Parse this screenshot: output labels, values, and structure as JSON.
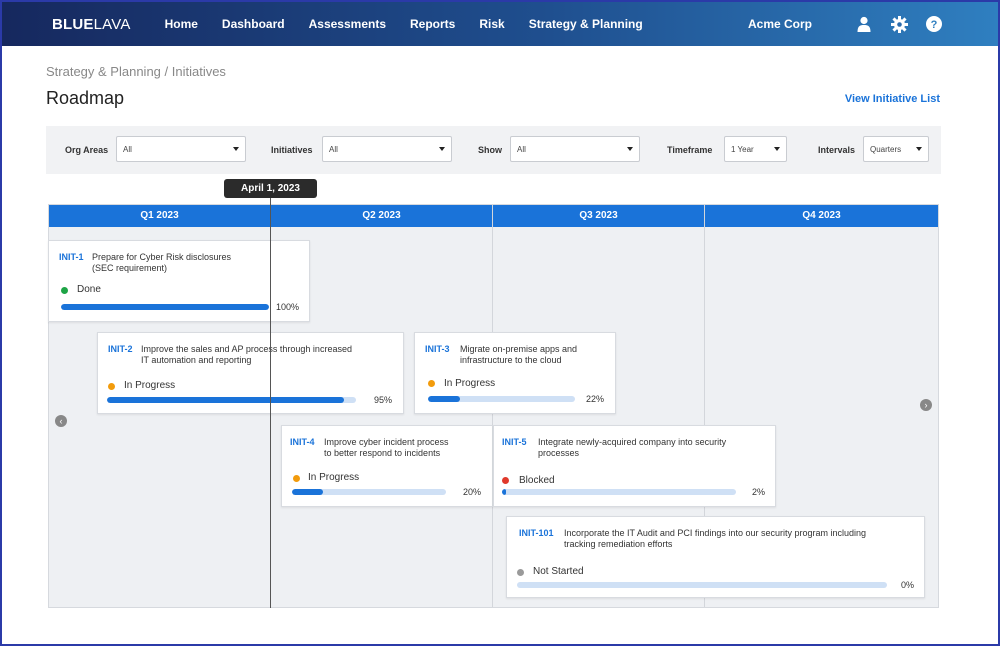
{
  "app": {
    "logo_blue": "BLUE",
    "logo_lava": "LAVA",
    "org_name": "Acme Corp"
  },
  "nav": [
    "Home",
    "Dashboard",
    "Assessments",
    "Reports",
    "Risk",
    "Strategy & Planning"
  ],
  "icons": {
    "user": "user-icon",
    "settings": "gear-icon",
    "help": "help-icon"
  },
  "breadcrumb": "Strategy & Planning / Initiatives",
  "page_title": "Roadmap",
  "view_link": "View Initiative List",
  "filters": {
    "org_areas": {
      "label": "Org Areas",
      "value": "All"
    },
    "initiatives": {
      "label": "Initiatives",
      "value": "All"
    },
    "show": {
      "label": "Show",
      "value": "All"
    },
    "timeframe": {
      "label": "Timeframe",
      "value": "1 Year"
    },
    "intervals": {
      "label": "Intervals",
      "value": "Quarters"
    }
  },
  "date_marker": "April 1, 2023",
  "quarters": [
    "Q1 2023",
    "Q2 2023",
    "Q3 2023",
    "Q4 2023"
  ],
  "colors": {
    "accent": "#1a73d9",
    "done": "#1ea446",
    "in_progress": "#f29b0c",
    "blocked": "#e0392b",
    "not_started": "#9a9a9a"
  },
  "initiatives": [
    {
      "id": "INIT-1",
      "title_1": "Prepare for Cyber Risk disclosures",
      "title_2": "(SEC requirement)",
      "status": "Done",
      "progress": 1.0,
      "pct": "100%"
    },
    {
      "id": "INIT-2",
      "title_1": "Improve the sales and AP process through increased",
      "title_2": "IT automation and reporting",
      "status": "In Progress",
      "progress": 0.95,
      "pct": "95%"
    },
    {
      "id": "INIT-3",
      "title_1": "Migrate on-premise apps and",
      "title_2": "infrastructure to the cloud",
      "status": "In Progress",
      "progress": 0.22,
      "pct": "22%"
    },
    {
      "id": "INIT-4",
      "title_1": "Improve cyber incident process",
      "title_2": "to better respond to incidents",
      "status": "In Progress",
      "progress": 0.2,
      "pct": "20%"
    },
    {
      "id": "INIT-5",
      "title_1": "Integrate newly-acquired company into security",
      "title_2": "processes",
      "status": "Blocked",
      "progress": 0.02,
      "pct": "2%"
    },
    {
      "id": "INIT-101",
      "title_1": "Incorporate the IT Audit and PCI findings into our security program including",
      "title_2": "tracking remediation efforts",
      "status": "Not Started",
      "progress": 0.0,
      "pct": "0%"
    }
  ]
}
